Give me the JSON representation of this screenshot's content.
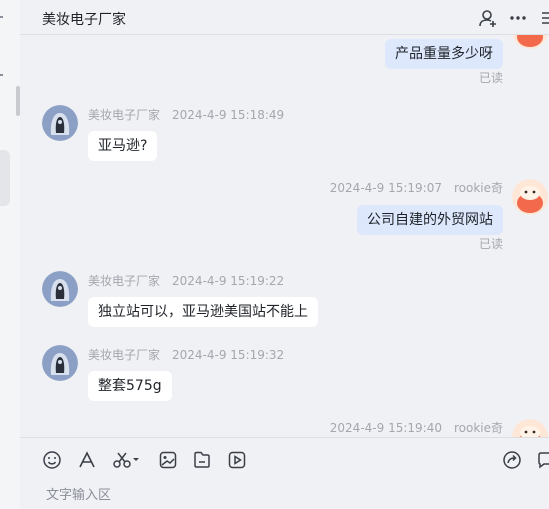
{
  "header": {
    "title": "美妆电子厂家"
  },
  "messages": [
    {
      "direction": "out",
      "text": "产品重量多少呀",
      "status": "已读"
    },
    {
      "direction": "in",
      "sender": "美妆电子厂家",
      "time": "2024-4-9 15:18:49",
      "text": "亚马逊?"
    },
    {
      "direction": "out",
      "sender": "rookie奇",
      "time": "2024-4-9 15:19:07",
      "text": "公司自建的外贸网站",
      "status": "已读"
    },
    {
      "direction": "in",
      "sender": "美妆电子厂家",
      "time": "2024-4-9 15:19:22",
      "text": "独立站可以，亚马逊美国站不能上"
    },
    {
      "direction": "in",
      "sender": "美妆电子厂家",
      "time": "2024-4-9 15:19:32",
      "text": "整套575g"
    },
    {
      "direction": "out",
      "sender": "rookie奇",
      "time": "2024-4-9 15:19:40"
    }
  ],
  "composer": {
    "placeholder": "文字输入区"
  },
  "icons": {
    "header": [
      "add-user-icon",
      "more-icon"
    ],
    "toolbar": [
      "emoji-icon",
      "font-icon",
      "scissors-icon",
      "image-icon",
      "file-icon",
      "video-icon",
      "share-icon",
      "chat-icon"
    ]
  },
  "colors": {
    "outgoing_bubble": "#dde8fd",
    "incoming_bubble": "#ffffff",
    "background": "#f0f1f4"
  }
}
